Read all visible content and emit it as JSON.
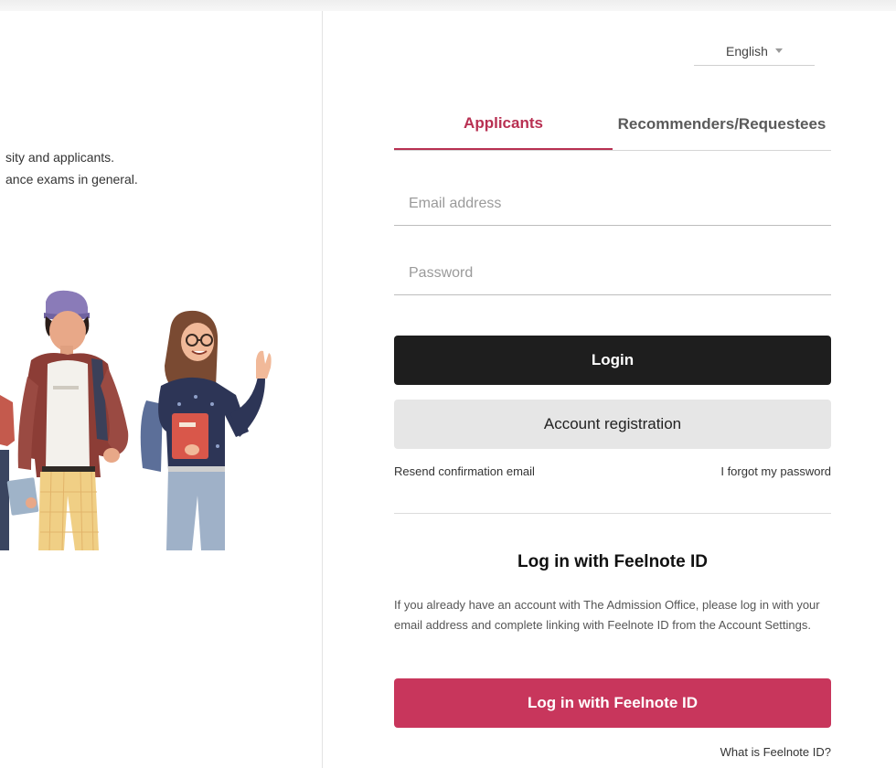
{
  "left": {
    "intro_line1": "sity and applicants.",
    "intro_line2": "ance exams in general."
  },
  "language": {
    "selected": "English"
  },
  "tabs": [
    {
      "label": "Applicants",
      "active": true
    },
    {
      "label": "Recommenders/Requestees",
      "active": false
    }
  ],
  "form": {
    "email_placeholder": "Email address",
    "password_placeholder": "Password",
    "login_label": "Login",
    "register_label": "Account registration",
    "resend_link": "Resend confirmation email",
    "forgot_link": "I forgot my password"
  },
  "feelnote": {
    "title": "Log in with Feelnote ID",
    "description": "If you already have an account with The Admission Office, please log in with your email address and complete linking with Feelnote ID from the Account Settings.",
    "button_label": "Log in with Feelnote ID",
    "what_link": "What is Feelnote ID?"
  },
  "colors": {
    "accent": "#b83052",
    "feelnote_button": "#c8365c",
    "login_button": "#1e1e1e",
    "register_button": "#e6e6e6"
  }
}
